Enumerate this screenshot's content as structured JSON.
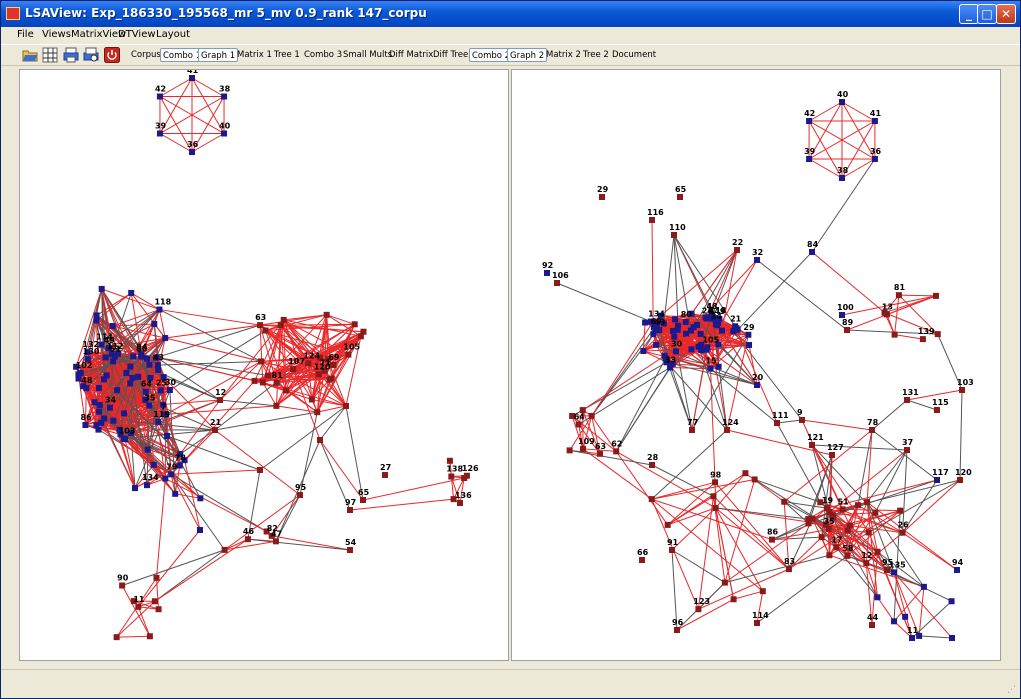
{
  "window": {
    "title": "LSAView: Exp_186330_195568_mr 5_mv 0.9_rank 147_corpu",
    "minimize_glyph": "_",
    "maximize_glyph": "□",
    "close_glyph": "✕"
  },
  "menu": [
    "File",
    "Views",
    "MatrixView",
    "DTView",
    "Layout"
  ],
  "toolbar": {
    "icons": [
      "open-folder-icon",
      "grid-icon",
      "print-icon",
      "print-preview-icon",
      "power-icon"
    ],
    "tabs": [
      {
        "label": "Corpus",
        "boxed": false
      },
      {
        "label": "Combo 1",
        "boxed": true
      },
      {
        "label": "Graph 1",
        "boxed": true
      },
      {
        "label": "Matrix 1",
        "boxed": false
      },
      {
        "label": "Tree 1",
        "boxed": false
      },
      {
        "label": "Combo 3",
        "boxed": false
      },
      {
        "label": "Small Mults",
        "boxed": false
      },
      {
        "label": "Diff Matrix",
        "boxed": false
      },
      {
        "label": "Diff Tree",
        "boxed": false
      },
      {
        "label": "Combo 2",
        "boxed": true
      },
      {
        "label": "Graph 2",
        "boxed": true
      },
      {
        "label": "Matrix 2",
        "boxed": false
      },
      {
        "label": "Tree 2",
        "boxed": false
      },
      {
        "label": "Document",
        "boxed": false
      }
    ]
  },
  "colors": {
    "edge_red": "#e8282a",
    "edge_gray": "#555555",
    "node_blue": "#1a1a8c",
    "node_red": "#8b1a1a"
  },
  "left_graph": {
    "labels": [
      "41",
      "38",
      "40",
      "36",
      "39",
      "42",
      "30",
      "49",
      "34",
      "48",
      "35",
      "7",
      "43",
      "64",
      "25",
      "103",
      "86",
      "132",
      "102",
      "112",
      "119",
      "114",
      "130",
      "51",
      "84",
      "118",
      "80",
      "69",
      "71",
      "63",
      "81",
      "120",
      "124",
      "107",
      "105",
      "134",
      "78",
      "79",
      "138",
      "126",
      "136",
      "11",
      "90",
      "82",
      "46",
      "47",
      "65",
      "27",
      "97",
      "95",
      "54",
      "21",
      "12"
    ]
  },
  "right_graph": {
    "labels": [
      "40",
      "41",
      "36",
      "38",
      "39",
      "42",
      "34",
      "15",
      "30",
      "48",
      "43",
      "24",
      "69",
      "8",
      "21",
      "49",
      "33",
      "29",
      "105",
      "134",
      "118",
      "80",
      "139",
      "81",
      "13",
      "35",
      "19",
      "12",
      "51",
      "58",
      "17",
      "26",
      "62",
      "109",
      "64",
      "63",
      "98",
      "83",
      "123",
      "86",
      "135",
      "29",
      "65",
      "116",
      "110",
      "106",
      "92",
      "22",
      "84",
      "32",
      "100",
      "89",
      "20",
      "9",
      "78",
      "131",
      "115",
      "103",
      "37",
      "28",
      "77",
      "124",
      "111",
      "121",
      "127",
      "117",
      "120",
      "94",
      "66",
      "91",
      "95",
      "44",
      "96",
      "114",
      "11"
    ]
  }
}
